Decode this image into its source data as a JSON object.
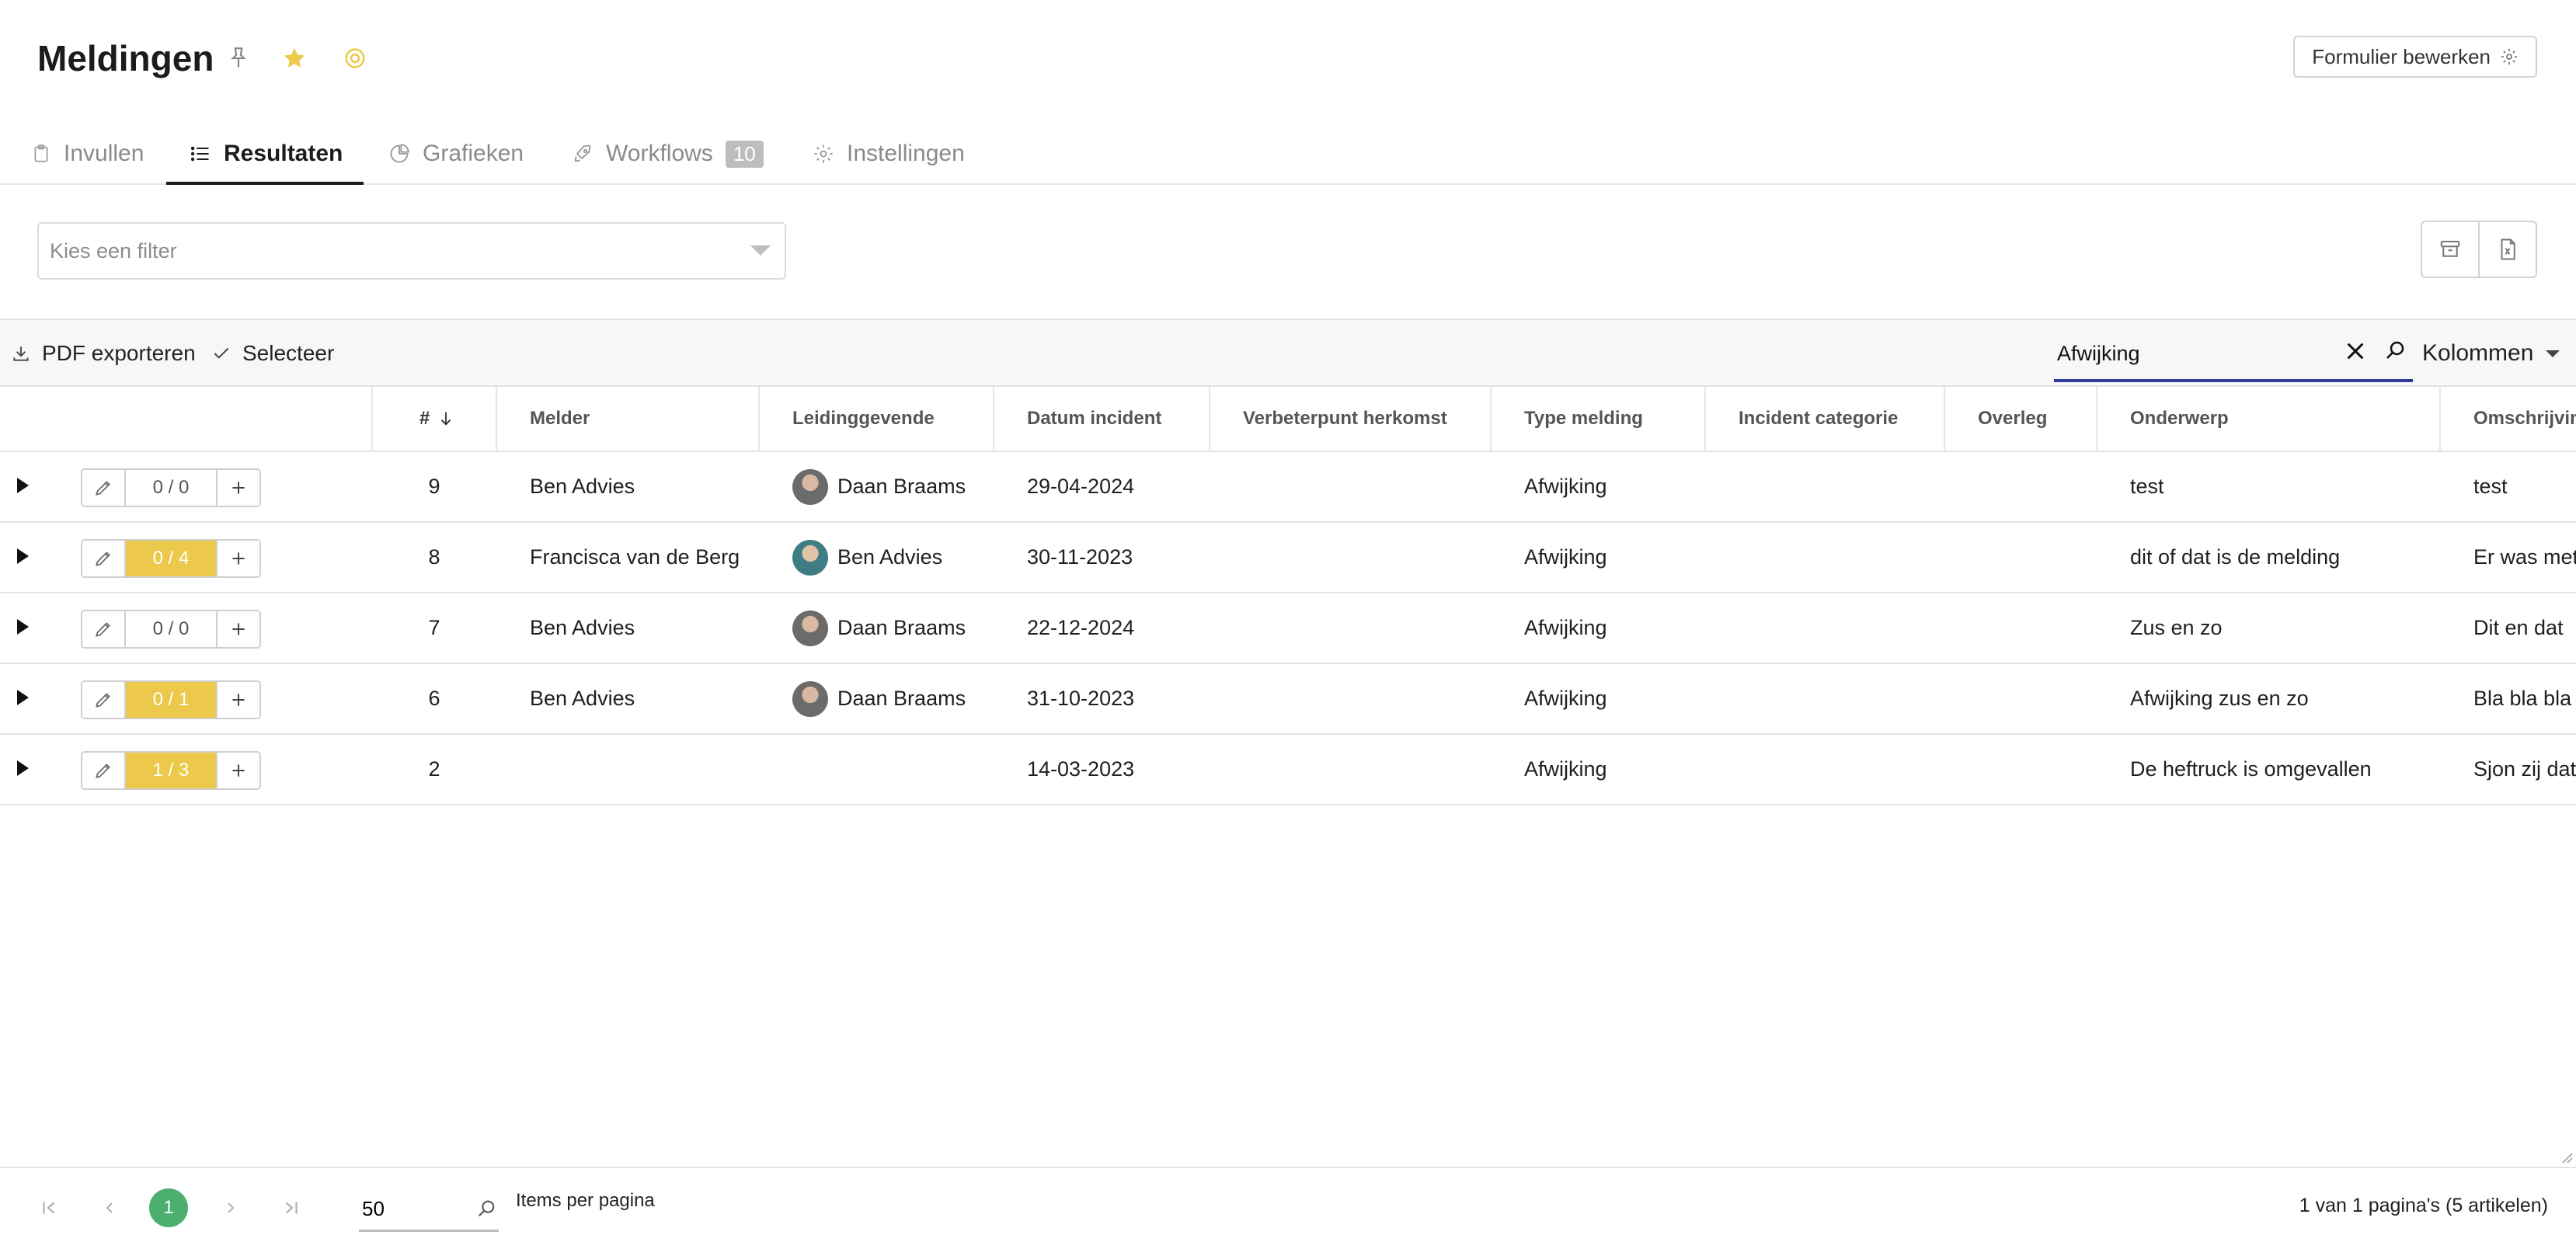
{
  "header": {
    "title": "Meldingen",
    "edit_form_label": "Formulier bewerken"
  },
  "tabs": [
    {
      "label": "Invullen",
      "icon": "clipboard-icon"
    },
    {
      "label": "Resultaten",
      "icon": "list-icon",
      "active": true
    },
    {
      "label": "Grafieken",
      "icon": "pie-chart-icon"
    },
    {
      "label": "Workflows",
      "icon": "rocket-icon",
      "badge": "10"
    },
    {
      "label": "Instellingen",
      "icon": "gear-icon"
    }
  ],
  "filter": {
    "placeholder": "Kies een filter"
  },
  "toolbar": {
    "pdf_export_label": "PDF exporteren",
    "select_label": "Selecteer",
    "search_value": "Afwijking",
    "columns_label": "Kolommen"
  },
  "table": {
    "columns": {
      "number": "#",
      "melder": "Melder",
      "leidinggevende": "Leidinggevende",
      "datum_incident": "Datum incident",
      "verbeterpunt_herkomst": "Verbeterpunt herkomst",
      "type_melding": "Type melding",
      "incident_categorie": "Incident categorie",
      "overleg": "Overleg",
      "onderwerp": "Onderwerp",
      "omschrijving": "Omschrijving"
    },
    "rows": [
      {
        "count": "0 / 0",
        "highlight": false,
        "number": "9",
        "melder": "Ben Advies",
        "leidinggevende": "Daan Braams",
        "datum": "29-04-2024",
        "verbeterpunt": "",
        "type": "Afwijking",
        "categorie": "",
        "overleg": "",
        "onderwerp": "test",
        "omschrijving": "test"
      },
      {
        "count": "0 / 4",
        "highlight": true,
        "number": "8",
        "melder": "Francisca van de Berg",
        "leidinggevende": "Ben Advies",
        "datum": "30-11-2023",
        "verbeterpunt": "",
        "type": "Afwijking",
        "categorie": "",
        "overleg": "",
        "onderwerp": "dit of dat is de melding",
        "omschrijving": "Er was met"
      },
      {
        "count": "0 / 0",
        "highlight": false,
        "number": "7",
        "melder": "Ben Advies",
        "leidinggevende": "Daan Braams",
        "datum": "22-12-2024",
        "verbeterpunt": "",
        "type": "Afwijking",
        "categorie": "",
        "overleg": "",
        "onderwerp": "Zus en zo",
        "omschrijving": "Dit en dat"
      },
      {
        "count": "0 / 1",
        "highlight": true,
        "number": "6",
        "melder": "Ben Advies",
        "leidinggevende": "Daan Braams",
        "datum": "31-10-2023",
        "verbeterpunt": "",
        "type": "Afwijking",
        "categorie": "",
        "overleg": "",
        "onderwerp": "Afwijking zus en zo",
        "omschrijving": "Bla bla bla"
      },
      {
        "count": "1 / 3",
        "highlight": true,
        "number": "2",
        "melder": "",
        "leidinggevende": "",
        "datum": "14-03-2023",
        "verbeterpunt": "",
        "type": "Afwijking",
        "categorie": "",
        "overleg": "",
        "onderwerp": "De heftruck is omgevallen",
        "omschrijving": "Sjon zij dat"
      }
    ]
  },
  "pagination": {
    "current_page": "1",
    "per_page_value": "50",
    "per_page_label": "Items per pagina",
    "summary": "1 van 1 pagina's (5 artikelen)"
  },
  "colors": {
    "accent_underline": "#2e3a9c",
    "highlight_count": "#ecc94b",
    "current_page": "#4caf6e",
    "star": "#ecc94b"
  }
}
